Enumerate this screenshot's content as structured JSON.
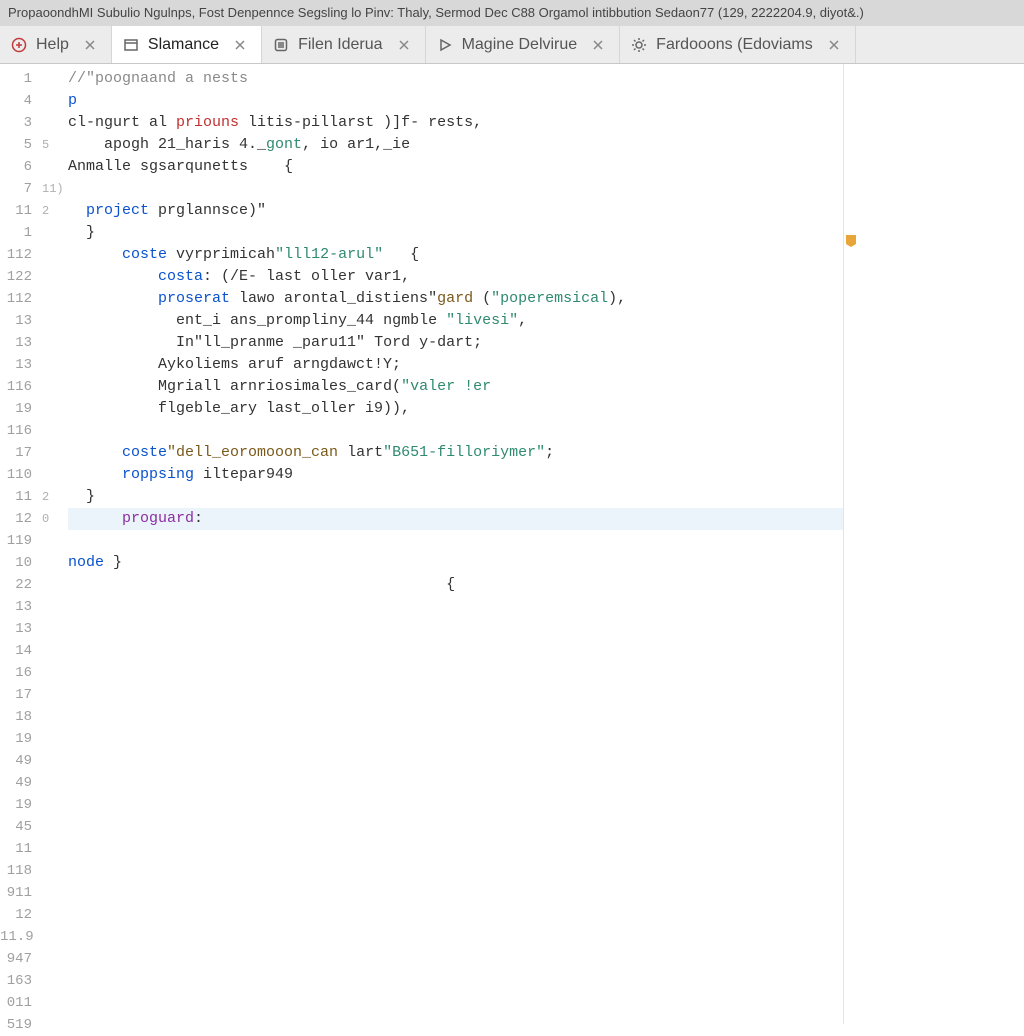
{
  "titlebar": "PropaoondhMI Subulio Ngulnps, Fost Denpennce Segsling lo Pinv: Thaly, Sermod Dec C88 Orgamol intibbution Sedaon77 (129, 2222204.9, diyot&.)",
  "tabs": [
    {
      "label": "Help",
      "icon": "circle-plus-icon",
      "close": true,
      "active": false
    },
    {
      "label": "Slamance",
      "icon": "window-icon",
      "close": true,
      "active": true
    },
    {
      "label": "Filen Iderua",
      "icon": "app-icon",
      "close": true,
      "active": false
    },
    {
      "label": "Magine Delvirue",
      "icon": "play-icon",
      "close": true,
      "active": false
    },
    {
      "label": "Fardooons (Edoviams",
      "icon": "gear-icon",
      "close": true,
      "active": false
    }
  ],
  "gutter_numbers": [
    "1",
    "4",
    "3",
    "5",
    "6",
    "7",
    "11",
    "1",
    "112",
    "122",
    "112",
    "13",
    "13",
    "13",
    "116",
    "19",
    "116",
    "17",
    "110",
    "11",
    "12",
    "119",
    "10",
    "22",
    "13",
    "13",
    "14",
    "16",
    "17",
    "18",
    "19",
    "49",
    "49",
    "19",
    "45",
    "11",
    "118",
    "911",
    "12",
    "11.9",
    "947",
    "163",
    "011",
    "519"
  ],
  "fold_marks": {
    "2": " ",
    "3": "5",
    "5": "11)",
    "6": "2",
    "19": "2",
    "20": "0"
  },
  "code_lines": [
    {
      "indent": 0,
      "tokens": [
        {
          "c": "tok-comment",
          "t": "//\"poognaand a nests"
        }
      ]
    },
    {
      "indent": 0,
      "tokens": [
        {
          "c": "tok-keyword",
          "t": "p"
        }
      ]
    },
    {
      "indent": 0,
      "tokens": [
        {
          "c": "tok-default",
          "t": "cl-ngurt al "
        },
        {
          "c": "tok-red",
          "t": "priouns"
        },
        {
          "c": "tok-default",
          "t": " litis-pillarst )]f- rests,"
        }
      ]
    },
    {
      "indent": 4,
      "tokens": [
        {
          "c": "tok-default",
          "t": "apogh 21_haris 4._"
        },
        {
          "c": "tok-teal",
          "t": "gont"
        },
        {
          "c": "tok-default",
          "t": ", io ar1,_ie"
        }
      ]
    },
    {
      "indent": 0,
      "tokens": [
        {
          "c": "tok-default",
          "t": "Anmalle sgsarqunetts    {"
        }
      ]
    },
    {
      "indent": 0,
      "tokens": []
    },
    {
      "indent": 2,
      "tokens": [
        {
          "c": "tok-keyword",
          "t": "project"
        },
        {
          "c": "tok-default",
          "t": " prglannsce)\""
        }
      ]
    },
    {
      "indent": 2,
      "tokens": [
        {
          "c": "tok-default",
          "t": "}"
        }
      ]
    },
    {
      "indent": 6,
      "tokens": [
        {
          "c": "tok-keyword",
          "t": "coste"
        },
        {
          "c": "tok-default",
          "t": " vyrprimicah"
        },
        {
          "c": "tok-string",
          "t": "\"lll12-arul\""
        },
        {
          "c": "tok-default",
          "t": "   {"
        }
      ]
    },
    {
      "indent": 10,
      "tokens": [
        {
          "c": "tok-keyword",
          "t": "costa"
        },
        {
          "c": "tok-default",
          "t": ": (/E- last oller var1,"
        }
      ]
    },
    {
      "indent": 10,
      "tokens": [
        {
          "c": "tok-keyword",
          "t": "proserat"
        },
        {
          "c": "tok-default",
          "t": " lawo arontal_distiens\""
        },
        {
          "c": "tok-brown",
          "t": "gard"
        },
        {
          "c": "tok-default",
          "t": " ("
        },
        {
          "c": "tok-string",
          "t": "\"poperemsical"
        },
        {
          "c": "tok-default",
          "t": "),"
        }
      ]
    },
    {
      "indent": 12,
      "tokens": [
        {
          "c": "tok-default",
          "t": "ent_i ans_prompliny_44 ngmble "
        },
        {
          "c": "tok-string",
          "t": "\"livesi\""
        },
        {
          "c": "tok-default",
          "t": ","
        }
      ]
    },
    {
      "indent": 12,
      "tokens": [
        {
          "c": "tok-default",
          "t": "In\"ll_pranme _paru11\" Tord y-dart;"
        }
      ]
    },
    {
      "indent": 10,
      "tokens": [
        {
          "c": "tok-default",
          "t": "Aykoliems aruf arngdawct!Y;"
        }
      ]
    },
    {
      "indent": 10,
      "tokens": [
        {
          "c": "tok-default",
          "t": "Mgriall arnriosimales_card("
        },
        {
          "c": "tok-string",
          "t": "\"valer !er"
        }
      ]
    },
    {
      "indent": 10,
      "tokens": [
        {
          "c": "tok-default",
          "t": "flgeble_ary last_oller i9)),"
        }
      ]
    },
    {
      "indent": 0,
      "tokens": []
    },
    {
      "indent": 6,
      "tokens": [
        {
          "c": "tok-keyword",
          "t": "coste"
        },
        {
          "c": "tok-brown",
          "t": "\"dell_eoromooon_can"
        },
        {
          "c": "tok-default",
          "t": " lart"
        },
        {
          "c": "tok-string",
          "t": "\"B651-filloriymer\""
        },
        {
          "c": "tok-default",
          "t": ";"
        }
      ]
    },
    {
      "indent": 6,
      "tokens": [
        {
          "c": "tok-keyword",
          "t": "roppsing"
        },
        {
          "c": "tok-default",
          "t": " iltepar949"
        }
      ]
    },
    {
      "indent": 2,
      "tokens": [
        {
          "c": "tok-default",
          "t": "}"
        }
      ]
    },
    {
      "indent": 6,
      "tokens": [
        {
          "c": "tok-purple",
          "t": "proguard"
        },
        {
          "c": "tok-default",
          "t": ":"
        }
      ],
      "current": true
    },
    {
      "indent": 0,
      "tokens": []
    },
    {
      "indent": 0,
      "tokens": [
        {
          "c": "tok-keyword",
          "t": "node"
        },
        {
          "c": "tok-default",
          "t": " }"
        }
      ]
    },
    {
      "indent": 42,
      "tokens": [
        {
          "c": "tok-default",
          "t": "{"
        }
      ]
    }
  ],
  "marker_top_px": 170,
  "colors": {
    "marker": "#e8a63a"
  }
}
